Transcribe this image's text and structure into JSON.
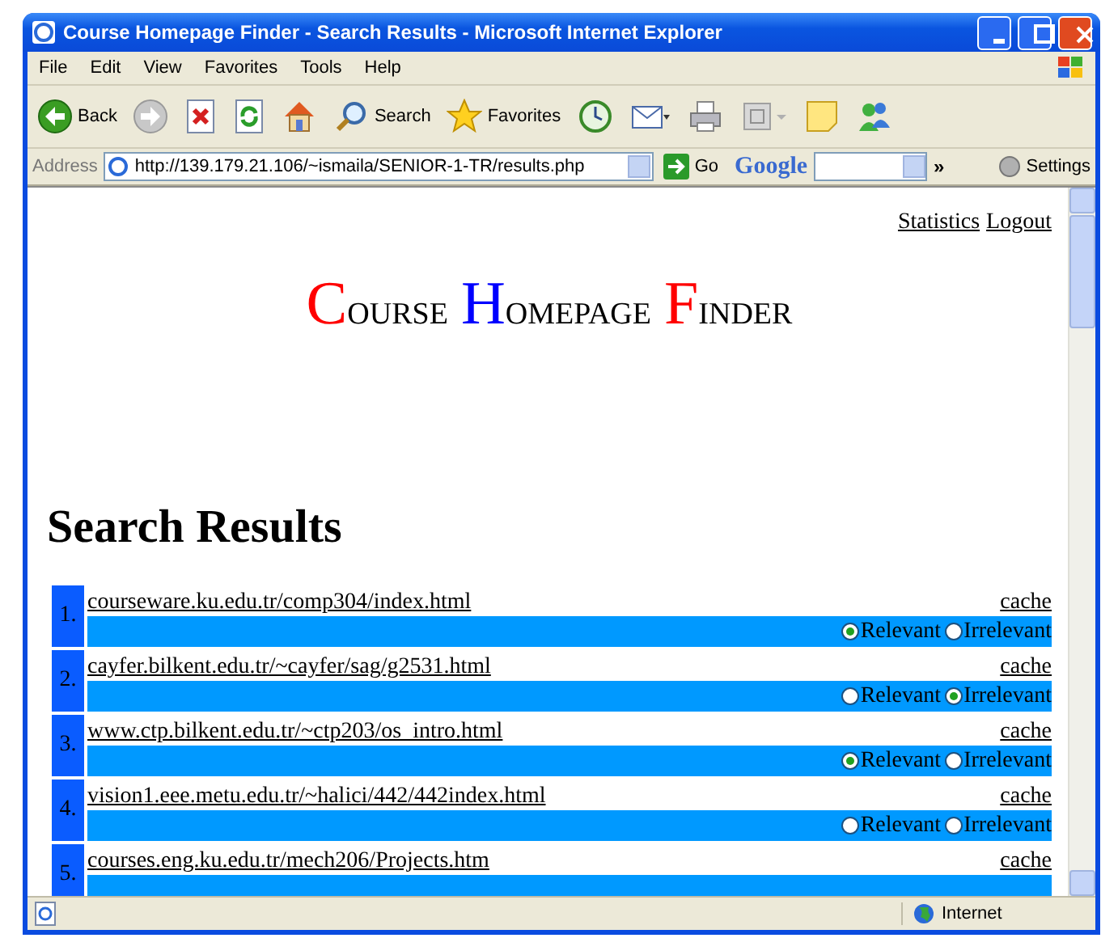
{
  "window": {
    "title": "Course Homepage Finder - Search Results - Microsoft Internet Explorer"
  },
  "menu": [
    "File",
    "Edit",
    "View",
    "Favorites",
    "Tools",
    "Help"
  ],
  "toolbar": [
    {
      "kind": "back",
      "label": "Back"
    },
    {
      "kind": "forward"
    },
    {
      "kind": "stop"
    },
    {
      "kind": "refresh"
    },
    {
      "kind": "home"
    },
    {
      "kind": "search",
      "label": "Search"
    },
    {
      "kind": "favorites",
      "label": "Favorites"
    },
    {
      "kind": "history"
    },
    {
      "kind": "mail"
    },
    {
      "kind": "print"
    },
    {
      "kind": "edit"
    },
    {
      "kind": "notes"
    },
    {
      "kind": "messenger"
    }
  ],
  "address_bar": {
    "label": "Address",
    "value": "http://139.179.21.106/~ismaila/SENIOR-1-TR/results.php",
    "go": "Go",
    "google": "Google",
    "more": "»",
    "settings": "Settings"
  },
  "header_links": [
    "Statistics",
    "Logout"
  ],
  "logo": [
    {
      "initial": "C",
      "rest": "OURSE",
      "color": "#ff0000"
    },
    {
      "initial": "H",
      "rest": "OMEPAGE",
      "color": "#0000ff"
    },
    {
      "initial": "F",
      "rest": "INDER",
      "color": "#ff0000"
    }
  ],
  "heading": "Search Results",
  "results": [
    {
      "number": "1.",
      "url": "courseware.ku.edu.tr/comp304/index.html",
      "cache": "cache",
      "options": [
        {
          "label": "Relevant",
          "selected": true
        },
        {
          "label": "Irrelevant",
          "selected": false
        }
      ]
    },
    {
      "number": "2.",
      "url": "cayfer.bilkent.edu.tr/~cayfer/sag/g2531.html",
      "cache": "cache",
      "options": [
        {
          "label": "Relevant",
          "selected": false
        },
        {
          "label": "Irrelevant",
          "selected": true
        }
      ]
    },
    {
      "number": "3.",
      "url": "www.ctp.bilkent.edu.tr/~ctp203/os_intro.html",
      "cache": "cache",
      "options": [
        {
          "label": "Relevant",
          "selected": true
        },
        {
          "label": "Irrelevant",
          "selected": false
        }
      ]
    },
    {
      "number": "4.",
      "url": "vision1.eee.metu.edu.tr/~halici/442/442index.html",
      "cache": "cache",
      "options": [
        {
          "label": "Relevant",
          "selected": false
        },
        {
          "label": "Irrelevant",
          "selected": false
        }
      ]
    },
    {
      "number": "5.",
      "url": "courses.eng.ku.edu.tr/mech206/Projects.htm",
      "cache": "cache"
    }
  ],
  "status_bar": {
    "zone": "Internet"
  }
}
